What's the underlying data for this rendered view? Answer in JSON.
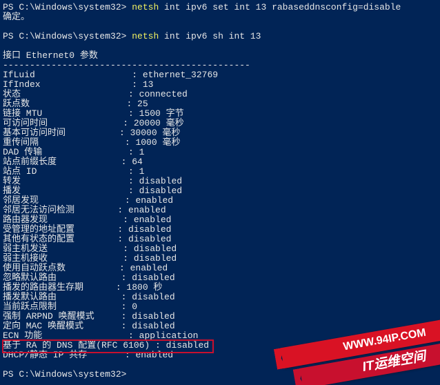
{
  "prompt_path": "PS C:\\Windows\\system32>",
  "cmd1_app": "netsh",
  "cmd1_rest": " int ipv6 set int 13 rabaseddnsconfig=disable",
  "confirm": "确定。",
  "cmd2_app": "netsh",
  "cmd2_rest": " int ipv6 sh int 13",
  "section_title": "接口 Ethernet0 参数",
  "divider": "----------------------------------------------",
  "props": [
    {
      "label": "IfLuid",
      "value": "ethernet_32769"
    },
    {
      "label": "IfIndex",
      "value": "13"
    },
    {
      "label": "状态",
      "value": "connected"
    },
    {
      "label": "跃点数",
      "value": "25"
    },
    {
      "label": "链接 MTU",
      "value": "1500 字节"
    },
    {
      "label": "可访问时间",
      "value": "20000 毫秒"
    },
    {
      "label": "基本可访问时间",
      "value": "30000 毫秒"
    },
    {
      "label": "重传间隔",
      "value": "1000 毫秒"
    },
    {
      "label": "DAD 传输",
      "value": "1"
    },
    {
      "label": "站点前缀长度",
      "value": "64"
    },
    {
      "label": "站点 ID",
      "value": "1"
    },
    {
      "label": "转发",
      "value": "disabled"
    },
    {
      "label": "播发",
      "value": "disabled"
    },
    {
      "label": "邻居发现",
      "value": "enabled"
    },
    {
      "label": "邻居无法访问检测",
      "value": "enabled"
    },
    {
      "label": "路由器发现",
      "value": "enabled"
    },
    {
      "label": "受管理的地址配置",
      "value": "disabled"
    },
    {
      "label": "其他有状态的配置",
      "value": "disabled"
    },
    {
      "label": "弱主机发送",
      "value": "disabled"
    },
    {
      "label": "弱主机接收",
      "value": "disabled"
    },
    {
      "label": "使用自动跃点数",
      "value": "enabled"
    },
    {
      "label": "忽略默认路由",
      "value": "disabled"
    },
    {
      "label": "播发的路由器生存期",
      "value": "1800 秒"
    },
    {
      "label": "播发默认路由",
      "value": "disabled"
    },
    {
      "label": "当前跃点限制",
      "value": "0"
    },
    {
      "label": "强制 ARPND 唤醒模式",
      "value": "disabled"
    },
    {
      "label": "定向 MAC 唤醒模式",
      "value": "disabled"
    },
    {
      "label": "ECN 功能",
      "value": "application"
    },
    {
      "label": "基于 RA 的 DNS 配置(RFC 6106)",
      "value": "disabled",
      "highlight": true
    },
    {
      "label": "DHCP/静态 IP 共存",
      "value": "enabled"
    }
  ],
  "ribbons": {
    "url": "WWW.94IP.COM",
    "brand": "IT运维空间"
  },
  "layout": {
    "label_cols": 24,
    "sep": ": "
  }
}
